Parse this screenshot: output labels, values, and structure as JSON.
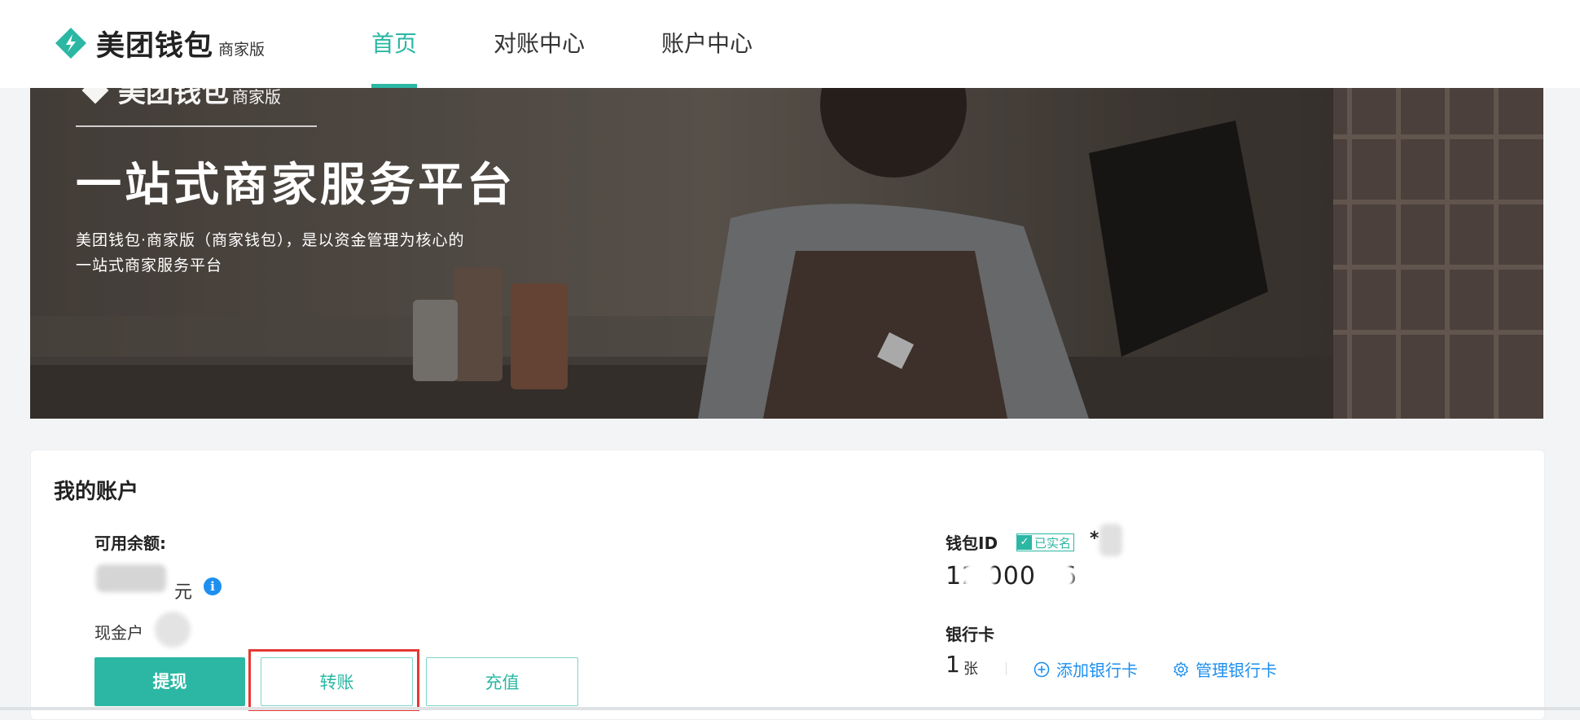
{
  "brand": {
    "name": "美团钱包",
    "edition": "商家版",
    "accent_color": "#2bb7a3"
  },
  "nav": {
    "items": [
      {
        "label": "首页",
        "active": true
      },
      {
        "label": "对账中心",
        "active": false
      },
      {
        "label": "账户中心",
        "active": false
      }
    ]
  },
  "banner": {
    "logo_name": "美团钱包",
    "logo_edition": "商家版",
    "title": "一站式商家服务平台",
    "description_line1": "美团钱包·商家版（商家钱包），是以资金管理为核心的",
    "description_line2": "一站式商家服务平台"
  },
  "account": {
    "section_title": "我的账户",
    "balance_label": "可用余额:",
    "balance_unit": "元",
    "info_icon": "info-icon",
    "cash_account_label": "现金户",
    "buttons": {
      "withdraw": "提现",
      "transfer": "转账",
      "recharge": "充值"
    },
    "wallet": {
      "label": "钱包ID",
      "verified_badge": "已实名",
      "id_prefix": "*",
      "id_value": "12   000    86"
    },
    "bank_card": {
      "label": "银行卡",
      "count": "1",
      "unit": "张",
      "add_label": "添加银行卡",
      "manage_label": "管理银行卡"
    }
  }
}
